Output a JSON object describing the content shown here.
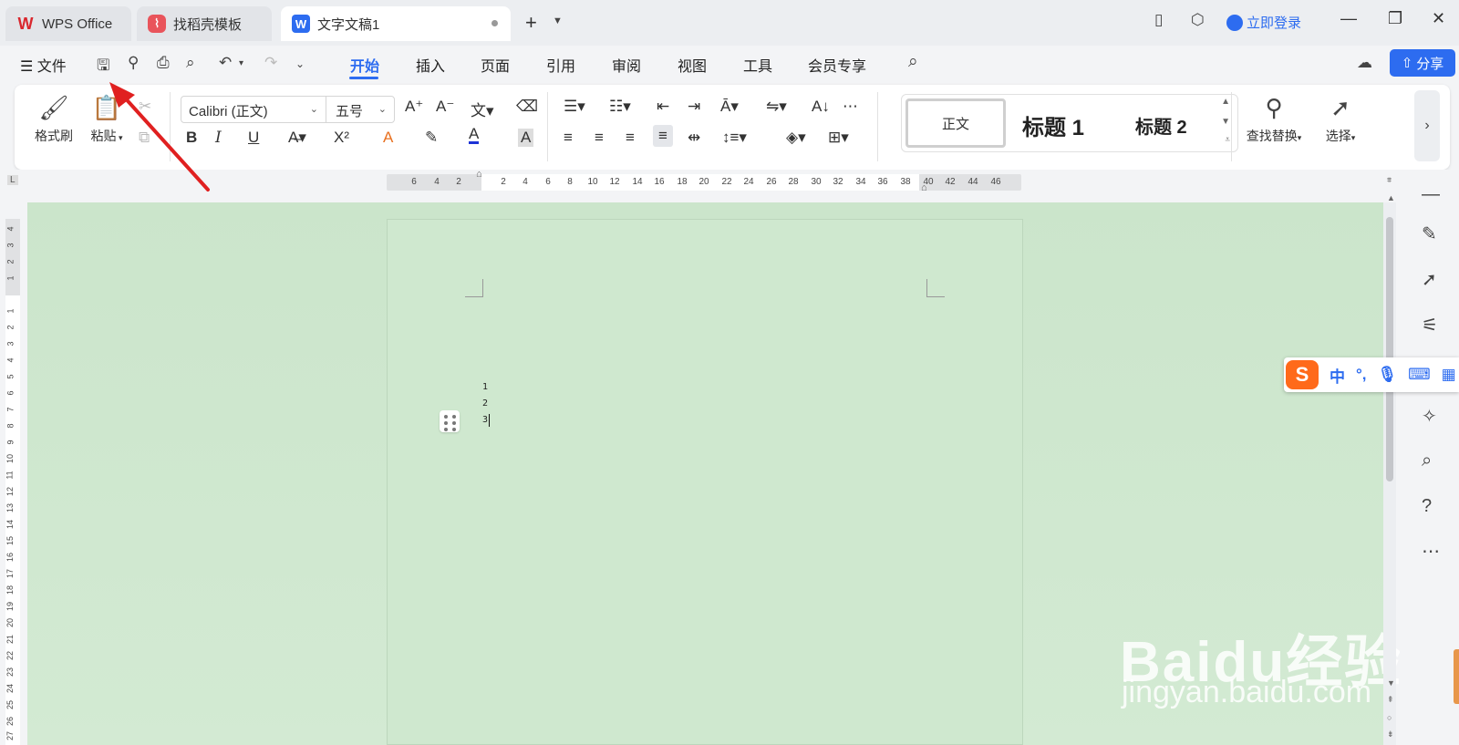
{
  "tabs": [
    {
      "label": "WPS Office",
      "icon": "wps-logo-icon"
    },
    {
      "label": "找稻壳模板",
      "icon": "docer-icon"
    },
    {
      "label": "文字文稿1",
      "icon": "writer-icon",
      "active": true
    }
  ],
  "titlebar": {
    "login_label": "立即登录"
  },
  "menu": {
    "file_label": "文件",
    "tabs": [
      "开始",
      "插入",
      "页面",
      "引用",
      "审阅",
      "视图",
      "工具",
      "会员专享"
    ],
    "active_tab": "开始",
    "share_label": "分享"
  },
  "ribbon": {
    "format_painter_label": "格式刷",
    "paste_label": "粘贴",
    "font_name": "Calibri (正文)",
    "font_size": "五号",
    "styles": {
      "normal": "正文",
      "h1": "标题 1",
      "h2": "标题 2"
    },
    "find_replace_label": "查找替换",
    "select_label": "选择",
    "bold_glyph": "B",
    "italic_glyph": "I",
    "underline_glyph": "U",
    "superscript_glyph": "X²"
  },
  "ruler": {
    "horizontal": [
      "6",
      "4",
      "2",
      "2",
      "4",
      "6",
      "8",
      "10",
      "12",
      "14",
      "16",
      "18",
      "20",
      "22",
      "24",
      "26",
      "28",
      "30",
      "32",
      "34",
      "36",
      "38",
      "40",
      "42",
      "44",
      "46"
    ],
    "vertical": [
      "4",
      "3",
      "2",
      "1",
      "1",
      "2",
      "3",
      "4",
      "5",
      "6",
      "7",
      "8",
      "9",
      "10",
      "11",
      "12",
      "13",
      "14",
      "15",
      "16",
      "17",
      "18",
      "19",
      "20",
      "21",
      "22",
      "23",
      "24",
      "25",
      "26",
      "27"
    ]
  },
  "document": {
    "lines": [
      "1",
      "2",
      "3"
    ]
  },
  "ime": {
    "mode_label": "中",
    "punct_label": "°,"
  },
  "watermark": {
    "logo": "Baidu经验",
    "url": "jingyan.baidu.com"
  },
  "colors": {
    "accent": "#2d6cf0",
    "doc_bg": "#cfe8cf",
    "annotation": "#e02020"
  }
}
